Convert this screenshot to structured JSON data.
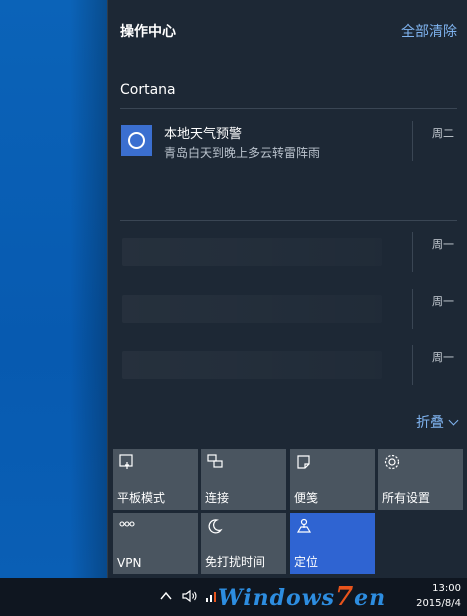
{
  "action_center": {
    "title": "操作中心",
    "clear_all": "全部清除",
    "collapse": "折叠"
  },
  "cortana": {
    "group_title": "Cortana",
    "notification": {
      "title": "本地天气预警",
      "body": "青岛白天到晚上多云转雷阵雨",
      "day": "周二",
      "icon": "cortana-ring-icon",
      "icon_color": "#3b6fd0"
    }
  },
  "blurred_notifications": [
    {
      "day": "周一"
    },
    {
      "day": "周一"
    },
    {
      "day": "周一"
    }
  ],
  "quick_actions": [
    {
      "label": "平板模式",
      "icon": "tablet-mode-icon",
      "active": false
    },
    {
      "label": "连接",
      "icon": "connect-icon",
      "active": false
    },
    {
      "label": "便笺",
      "icon": "note-icon",
      "active": false
    },
    {
      "label": "所有设置",
      "icon": "gear-icon",
      "active": false
    },
    {
      "label": "VPN",
      "icon": "vpn-icon",
      "active": false
    },
    {
      "label": "免打扰时间",
      "icon": "moon-icon",
      "active": false
    },
    {
      "label": "定位",
      "icon": "location-icon",
      "active": true
    }
  ],
  "colors": {
    "panel_bg": "#1d2835",
    "tile_bg": "#4a5560",
    "tile_active": "#2f64d2",
    "link": "#7fb3ef",
    "desktop": "#0a61b6"
  },
  "taskbar": {
    "tray_icons": [
      "chevron-up-icon",
      "speaker-icon",
      "network-icon"
    ],
    "watermark_prefix": "Windows",
    "watermark_seven": "7",
    "watermark_suffix": "en",
    "clock_time": "13:00",
    "clock_date": "2015/8/4"
  }
}
